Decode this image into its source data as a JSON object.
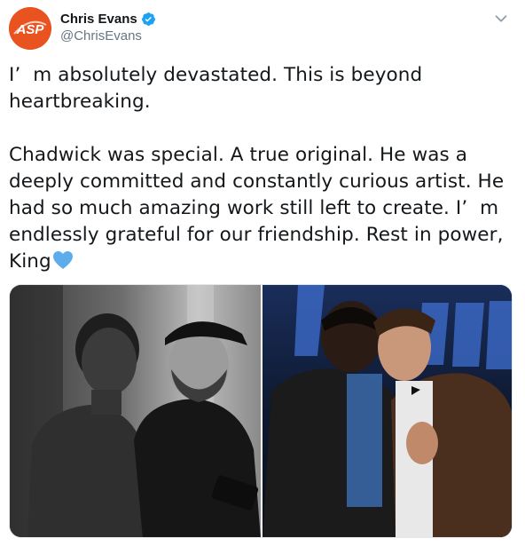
{
  "tweet": {
    "author": {
      "display_name": "Chris Evans",
      "handle": "@ChrisEvans",
      "verified": true,
      "avatar_text": "ASP",
      "avatar_color": "#e8531f"
    },
    "paragraphs": [
      "I’  m absolutely devastated. This is beyond heartbreaking.",
      "Chadwick was special. A true original. He was a deeply committed and constantly curious artist. He had so much amazing work still left to create. I’  m endlessly grateful for our friendship. Rest in power, King"
    ],
    "emoji": "blue-heart",
    "media": [
      {
        "type": "photo",
        "tone": "black-and-white"
      },
      {
        "type": "photo",
        "tone": "color"
      }
    ]
  },
  "colors": {
    "verified_blue": "#1da1f2",
    "text": "#14171a",
    "secondary_text": "#657786",
    "heart_blue": "#5dadec"
  }
}
